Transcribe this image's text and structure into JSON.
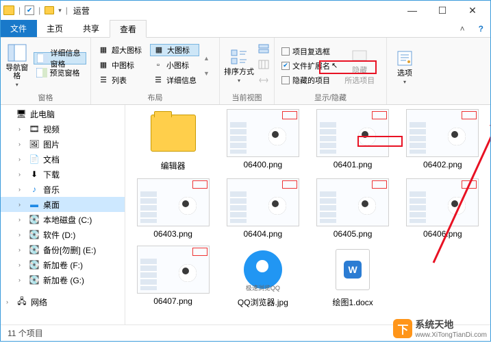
{
  "window": {
    "title": "运营",
    "min": "—",
    "max": "☐",
    "close": "✕"
  },
  "tabs": {
    "file": "文件",
    "home": "主页",
    "share": "共享",
    "view": "查看"
  },
  "ribbon": {
    "panes": {
      "nav_pane": "导航窗格",
      "details_pane": "详细信息窗格",
      "preview_pane": "预览窗格",
      "group": "窗格"
    },
    "layout": {
      "xlarge": "超大图标",
      "large": "大图标",
      "medium": "中图标",
      "small": "小图标",
      "list": "列表",
      "details": "详细信息",
      "group": "布局"
    },
    "current": {
      "sort": "排序方式",
      "group": "当前视图"
    },
    "showhide": {
      "checkboxes": "项目复选框",
      "extensions": "文件扩展名",
      "hidden": "隐藏的项目",
      "hide_btn": "隐藏",
      "hide_btn2": "所选项目",
      "group": "显示/隐藏"
    },
    "options": {
      "label": "选项"
    }
  },
  "tree": {
    "this_pc": "此电脑",
    "videos": "视频",
    "pictures": "图片",
    "documents": "文档",
    "downloads": "下载",
    "music": "音乐",
    "desktop": "桌面",
    "disk_c": "本地磁盘 (C:)",
    "disk_d": "软件 (D:)",
    "disk_e": "备份[勿删] (E:)",
    "disk_f": "新加卷 (F:)",
    "disk_g": "新加卷 (G:)",
    "network": "网络"
  },
  "files": [
    {
      "name": "编辑器",
      "kind": "folder"
    },
    {
      "name": "06400.png",
      "kind": "app"
    },
    {
      "name": "06401.png",
      "kind": "app"
    },
    {
      "name": "06402.png",
      "kind": "app"
    },
    {
      "name": "06403.png",
      "kind": "app"
    },
    {
      "name": "06404.png",
      "kind": "app"
    },
    {
      "name": "06405.png",
      "kind": "app"
    },
    {
      "name": "06406.png",
      "kind": "app"
    },
    {
      "name": "06407.png",
      "kind": "app"
    },
    {
      "name": "QQ浏览器.jpg",
      "kind": "qq"
    },
    {
      "name": "绘图1.docx",
      "kind": "doc"
    }
  ],
  "status": {
    "count": "11 个项目"
  },
  "watermark": {
    "name": "系统天地",
    "url": "www.XiTongTianDi.com"
  }
}
